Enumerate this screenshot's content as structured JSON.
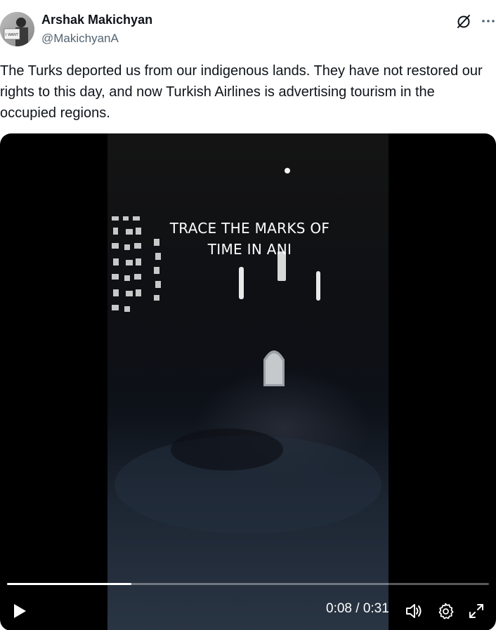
{
  "author": {
    "name": "Arshak Makichyan",
    "handle": "@MakichyanA",
    "avatar_sign_text": "I WANT"
  },
  "icons": {
    "grok": "grok-icon",
    "more": "more-icon",
    "play": "play-icon",
    "volume": "volume-icon",
    "settings": "gear-icon",
    "fullscreen": "fullscreen-icon"
  },
  "tweet": {
    "text": "The Turks deported us from our indigenous lands. They have not restored our rights to this day, and now Turkish Airlines is advertising tourism in the occupied regions."
  },
  "video": {
    "overlay_line1": "TRACE THE MARKS OF",
    "overlay_line2": "TIME IN ANI",
    "current_time": "0:08",
    "duration": "0:31",
    "progress_fraction": 0.258
  },
  "colors": {
    "text_primary": "#0f1419",
    "text_secondary": "#536471"
  }
}
